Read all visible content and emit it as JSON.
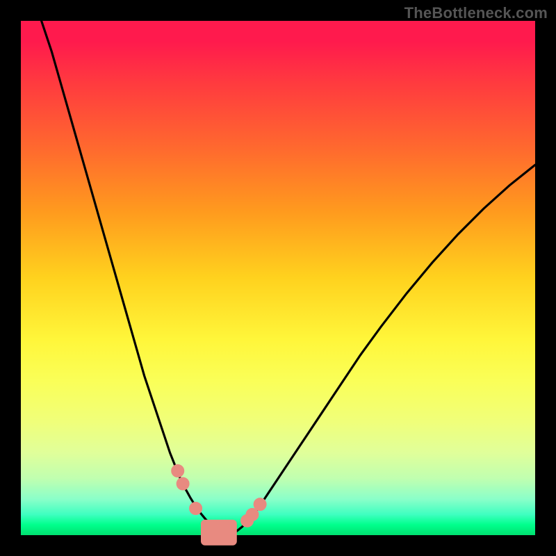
{
  "watermark": "TheBottleneck.com",
  "chart_data": {
    "type": "line",
    "title": "",
    "xlabel": "",
    "ylabel": "",
    "xlim": [
      0,
      100
    ],
    "ylim": [
      0,
      100
    ],
    "series": [
      {
        "name": "left-curve",
        "x": [
          4,
          6,
          8,
          10,
          12,
          14,
          16,
          18,
          20,
          22,
          24,
          26,
          27,
          28,
          29,
          30,
          31,
          32,
          33,
          34,
          35,
          36,
          37,
          38,
          39
        ],
        "y": [
          100,
          94,
          87,
          80,
          73,
          66,
          59,
          52,
          45,
          38,
          31,
          25,
          22,
          19,
          16,
          13.5,
          11,
          9,
          7.2,
          5.6,
          4.2,
          3,
          2,
          1.2,
          0.6
        ]
      },
      {
        "name": "right-curve",
        "x": [
          42,
          43,
          44,
          45,
          46,
          48,
          50,
          52,
          55,
          58,
          62,
          66,
          70,
          75,
          80,
          85,
          90,
          95,
          100
        ],
        "y": [
          0.8,
          1.6,
          2.6,
          3.8,
          5,
          8,
          11,
          14,
          18.5,
          23,
          29,
          35,
          40.5,
          47,
          53,
          58.5,
          63.5,
          68,
          72
        ]
      }
    ],
    "markers": [
      {
        "x": 30.5,
        "y": 12.5
      },
      {
        "x": 31.5,
        "y": 10.0
      },
      {
        "x": 34.0,
        "y": 5.2
      },
      {
        "x": 44.0,
        "y": 2.8
      },
      {
        "x": 45.0,
        "y": 4.0
      },
      {
        "x": 46.5,
        "y": 6.0
      }
    ],
    "bottom_marker_band": {
      "x_start": 35,
      "x_end": 42,
      "y": 0.5,
      "thickness": 2.0
    },
    "colors": {
      "curve": "#000000",
      "marker": "#e88a80",
      "gradient_top": "#ff1a4d",
      "gradient_bottom": "#00e070",
      "frame": "#000000",
      "watermark": "#555555"
    }
  }
}
